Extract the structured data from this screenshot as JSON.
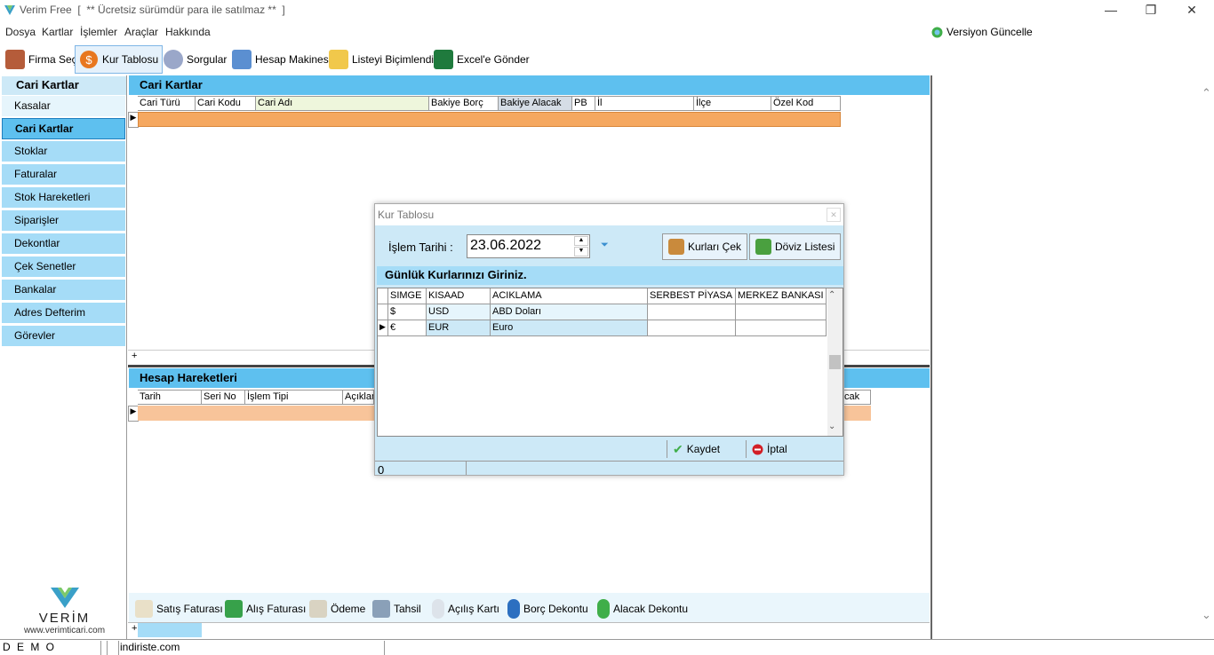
{
  "window": {
    "title": "Verim Free  [  ** Ücretsiz sürümdür para ile satılmaz **  ]",
    "minimize": "—",
    "restore": "❐",
    "close": "✕"
  },
  "menu": [
    "Dosya",
    "Kartlar",
    "İşlemler",
    "Araçlar",
    "Hakkında"
  ],
  "versiyon_label": "Versiyon Güncelle",
  "toolbar": [
    "Firma Seç",
    "Kur Tablosu",
    "Sorgular",
    "Hesap Makinesi",
    "Listeyi Biçimlendir",
    "Excel'e Gönder"
  ],
  "nav": {
    "header": "Cari Kartlar",
    "items": [
      "Kasalar",
      "Cari Kartlar",
      "Stoklar",
      "Faturalar",
      "Stok Hareketleri",
      "Siparişler",
      "Dekontlar",
      "Çek Senetler",
      "Bankalar",
      "Adres Defterim",
      "Görevler"
    ],
    "selected_index": 1
  },
  "brand": {
    "name": "VERİM",
    "url": "www.verimticari.com"
  },
  "cari": {
    "title": "Cari Kartlar",
    "columns": [
      "Cari Türü",
      "Cari Kodu",
      "Cari Adı",
      "Bakiye Borç",
      "Bakiye Alacak",
      "PB",
      "İl",
      "İlçe",
      "Özel Kod"
    ],
    "add_glyph": "+"
  },
  "hesap": {
    "title": "Hesap Hareketleri",
    "columns": [
      "Tarih",
      "Seri No",
      "İşlem Tipi",
      "Açıklama"
    ],
    "trailing_column": "cak"
  },
  "actions": [
    "Satış Faturası",
    "Alış Faturası",
    "Ödeme",
    "Tahsil",
    "Açılış Kartı",
    "Borç Dekontu",
    "Alacak Dekontu"
  ],
  "bottom_add_glyph": "+",
  "dialog": {
    "title": "Kur Tablosu",
    "date_label": "İşlem Tarihi :",
    "date_value": "23.06.2022",
    "btn_kurlari_cek": "Kurları Çek",
    "btn_doviz_listesi": "Döviz Listesi",
    "section_title": "Günlük Kurlarınızı Giriniz.",
    "columns": [
      "SIMGE",
      "KISAAD",
      "ACIKLAMA",
      "SERBEST PİYASA",
      "MERKEZ BANKASI"
    ],
    "rows": [
      {
        "simge": "$",
        "kisaad": "USD",
        "aciklama": "ABD Doları",
        "serbest": "",
        "merkez": ""
      },
      {
        "simge": "€",
        "kisaad": "EUR",
        "aciklama": "Euro",
        "serbest": "",
        "merkez": ""
      }
    ],
    "btn_kaydet": "Kaydet",
    "btn_iptal": "İptal",
    "footer_value": "0"
  },
  "status": {
    "left": "D E M O",
    "middle": "indiriste.com"
  },
  "colors": {
    "nav_item": "#a5dcf7",
    "header_blue": "#5ec0ef",
    "grid_row_orange": "#f5a860",
    "dialog_bg": "#cde9f7"
  }
}
